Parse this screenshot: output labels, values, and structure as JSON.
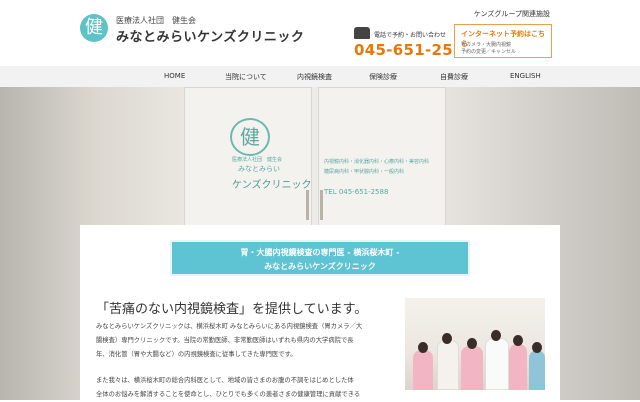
{
  "header": {
    "logo_mark": "健",
    "logo_sub": "医療法人社団　健生会",
    "logo_main": "みなとみらいケンズクリニック",
    "group_link": "ケンズグループ関連施設",
    "phone_caption": "電話で予約・お問い合わせ",
    "phone_number": "045-651-2588",
    "reserve": {
      "title": "インターネット予約はこちら",
      "line1": "胃カメラ・大腸内視鏡",
      "line2": "予約の変更／キャンセル"
    }
  },
  "nav": {
    "items": [
      "HOME",
      "当院について",
      "内視鏡検査",
      "保険診療",
      "自費診療",
      "ENGLISH"
    ]
  },
  "hero": {
    "sign_mark": "健",
    "sign_sub": "医療法人社団　健生会",
    "sign_line1": "みなとみらい",
    "sign_main": "ケンズクリニック",
    "door_lines": [
      "内視鏡内科・消化器内科・心療内科・美容内科",
      "糖尿病内科・甲状腺内科・一般内科"
    ],
    "door_phone": "TEL 045-651-2588"
  },
  "main": {
    "banner_line1": "胃・大腸内視鏡検査の専門医 - 横浜桜木町 -",
    "banner_line2": "みなとみらいケンズクリニック",
    "lead": "「苦痛のない内視鏡検査」を提供しています。",
    "para1": [
      "みなとみらいケンズクリニックは、横浜桜木町 みなとみらいにある内視鏡検査（胃カメラ／大",
      "腸検査）専門クリニックです。当院の常勤医師、非常勤医師はいずれも県内の大学病院で長",
      "年、消化管（胃や大腸など）の内視鏡検査に従事してきた専門医です。"
    ],
    "para2": [
      "また我々は、横浜桜木町の総合内科医として、地域の皆さまのお腹の不調をはじめとした体",
      "全体のお悩みを解消することを使命とし、ひとりでも多くの患者さまの健康管理に貢献できる"
    ]
  },
  "colors": {
    "accent": "#5ec3d2",
    "phone": "#e8770a",
    "brand": "#5ec3c6"
  }
}
